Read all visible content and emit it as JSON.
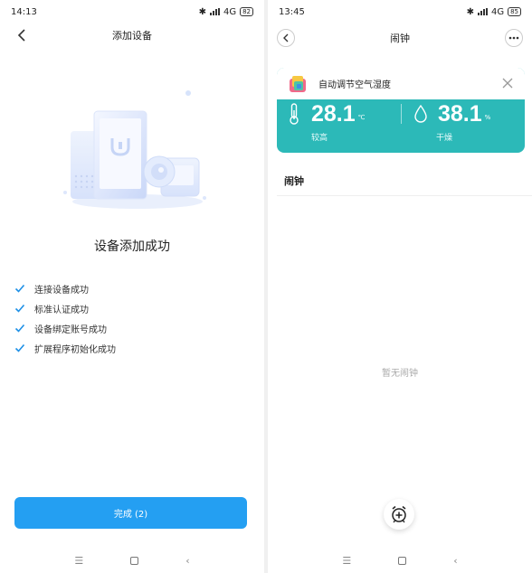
{
  "left": {
    "status": {
      "time": "14:13",
      "network": "4G",
      "battery": "82"
    },
    "nav": {
      "title": "添加设备"
    },
    "success_title": "设备添加成功",
    "steps": [
      {
        "label": "连接设备成功"
      },
      {
        "label": "标准认证成功"
      },
      {
        "label": "设备绑定账号成功"
      },
      {
        "label": "扩展程序初始化成功"
      }
    ],
    "done_button": "完成 (2)"
  },
  "right": {
    "status": {
      "time": "13:45",
      "network": "4G",
      "battery": "85"
    },
    "nav": {
      "title": "闹钟"
    },
    "card": {
      "banner_text": "自动调节空气湿度",
      "temperature": {
        "value": "28.1",
        "unit": "℃",
        "label": "较高"
      },
      "humidity": {
        "value": "38.1",
        "unit": "%",
        "label": "干燥"
      },
      "card_color": "#2cb9b8"
    },
    "section_title": "闹钟",
    "empty_text": "暂无闹钟"
  },
  "colors": {
    "accent": "#249ff2",
    "check": "#1e90e6"
  },
  "icons": [
    "back-icon",
    "menu-icon",
    "close-icon",
    "thermometer-icon",
    "droplet-icon",
    "alarm-add-icon",
    "check-icon"
  ]
}
